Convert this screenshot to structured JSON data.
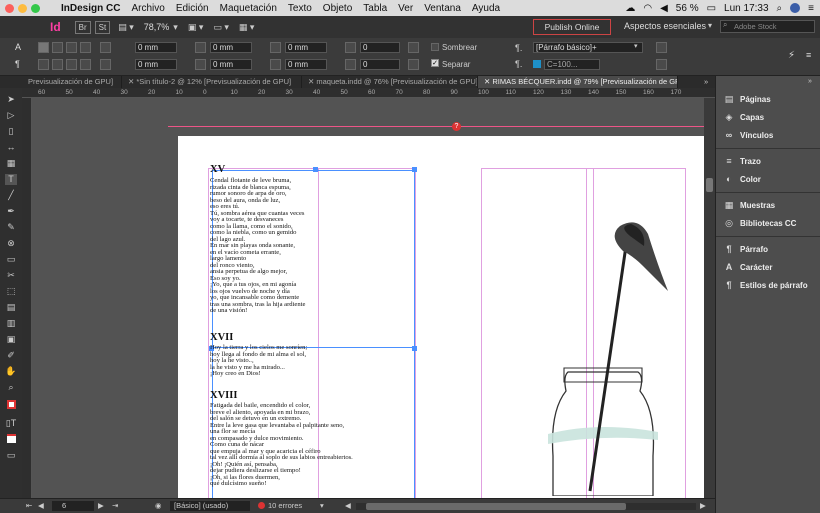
{
  "menubar": {
    "app_name": "InDesign CC",
    "items": [
      "Archivo",
      "Edición",
      "Maquetación",
      "Texto",
      "Objeto",
      "Tabla",
      "Ver",
      "Ventana",
      "Ayuda"
    ],
    "battery": "56 %",
    "clock": "Lun 17:33"
  },
  "appbar": {
    "logo": "Id",
    "br_label": "Br",
    "st_label": "St",
    "zoom": "78,7%",
    "publish_label": "Publish Online",
    "workspace": "Aspectos esenciales",
    "search_placeholder": "Adobe Stock"
  },
  "control": {
    "f1": "0 mm",
    "f2": "0 mm",
    "f3": "0 mm",
    "f4": "0 mm",
    "f5": "0 mm",
    "f6": "0 mm",
    "f7": "0",
    "f8": "0",
    "sombrear_label": "Sombrear",
    "separar_label": "Separar",
    "style": "[Párrafo básico]+",
    "color_field": "C=100..."
  },
  "tabs": [
    "Previsualización de GPU]",
    "*Sin título-2 @ 12% [Previsualización de GPU]",
    "maqueta.indd @ 76% [Previsualización de GPU]",
    "RIMAS BÉCQUER.indd @ 79% [Previsualización de GPU]"
  ],
  "ruler_ticks": [
    "60",
    "50",
    "40",
    "30",
    "20",
    "10",
    "0",
    "10",
    "20",
    "30",
    "40",
    "50",
    "60",
    "70",
    "80",
    "90",
    "100",
    "110",
    "120",
    "130",
    "140",
    "150",
    "160",
    "170"
  ],
  "page": {
    "h1": "XV",
    "p1": "Cendal flotante de leve bruma,\nrizada cinta de blanca espuma,\nrumor sonoro de arpa de oro,\nbeso del aura, onda de luz,\neso eres tú.\nTú, sombra aérea que cuantas veces\nvoy a tocarte, te desvaneces\ncomo la llama, como el sonido,\ncomo la niebla, como un gemido\ndel lago azul.\nEn mar sin playas onda sonante,\nen el vacío cometa errante,\nlargo lamento\ndel ronco viento,\nansia perpetua de algo mejor,\nEso soy yo.\n¡Yo, que a tus ojos, en mi agonía\nlos ojos vuelvo de noche y día\nyo, que incansable como demente\ntras una sombra, tras la hija ardiente\nde una visión!",
    "h2": "XVII",
    "p2": "Hoy la tierra y los cielos me sonríen;\nhoy llega al fondo de mi alma el sol,\nhoy la he visto..,\nla he visto y me ha mirado...\n¡Hoy creo en Dios!",
    "h3": "XVIII",
    "p3": "Fatigada del baile, encendido el color,\nbreve el aliento, apoyada en mi brazo,\ndel salón se detuvo en un extremo.\nEntre la leve gasa que levantaba el palpitante seno,\nuna flor se mecía\nen compasado y dulce movimiento.\nComo cuna de nácar\nque empuja al mar y que acaricia el céfiro\ntal vez allí dormía al soplo de sus labios entreabiertos.\n¡Oh! ¡Quién así, pensaba,\ndejar pudiera deslizarse el tiempo!\n¡Oh, si las flores duermen,\nqué dulcísimo sueño!"
  },
  "status": {
    "page_number": "6",
    "style_label": "[Básico] (usado)",
    "errors": "10 errores"
  },
  "panel": {
    "paginas": "Páginas",
    "capas": "Capas",
    "vinculos": "Vínculos",
    "trazo": "Trazo",
    "color": "Color",
    "muestras": "Muestras",
    "bibliotecas": "Bibliotecas CC",
    "parrafo": "Párrafo",
    "caracter": "Carácter",
    "estilos": "Estilos de párrafo"
  },
  "colors": {
    "accent_pink": "#e0a0e0",
    "guide_blue": "#4a90ff",
    "error_red": "#d33"
  }
}
